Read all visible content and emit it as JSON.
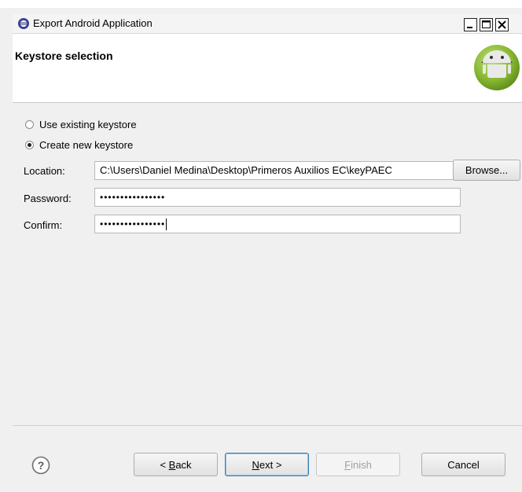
{
  "window": {
    "title": "Export Android Application"
  },
  "header": {
    "title": "Keystore selection"
  },
  "options": {
    "use_existing": "Use existing keystore",
    "create_new": "Create new keystore",
    "selected": "create_new"
  },
  "form": {
    "location_label": "Location:",
    "location_value": "C:\\Users\\Daniel Medina\\Desktop\\Primeros Auxilios EC\\keyPAEC",
    "browse_label": "Browse...",
    "password_label": "Password:",
    "password_value": "••••••••••••••••",
    "confirm_label": "Confirm:",
    "confirm_value": "••••••••••••••••"
  },
  "footer": {
    "back_mnemonic": "B",
    "back_rest": "ack",
    "next_mnemonic": "N",
    "next_rest": "ext >",
    "finish_mnemonic": "F",
    "finish_rest": "inish",
    "cancel_label": "Cancel"
  }
}
